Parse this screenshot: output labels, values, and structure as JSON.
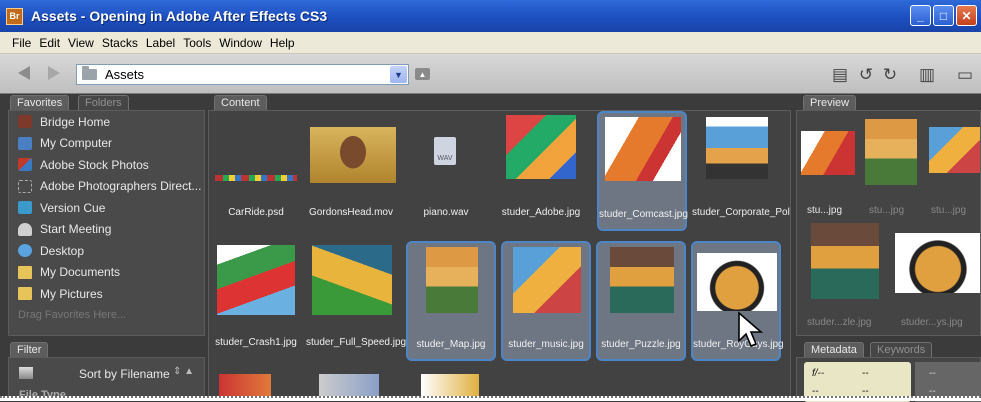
{
  "window": {
    "title": "Assets - Opening in Adobe After Effects CS3",
    "logo": "Br"
  },
  "menu": [
    "File",
    "Edit",
    "View",
    "Stacks",
    "Label",
    "Tools",
    "Window",
    "Help"
  ],
  "toolbar": {
    "path": "Assets"
  },
  "tabs": {
    "favorites": "Favorites",
    "folders": "Folders",
    "content": "Content",
    "preview": "Preview",
    "filter": "Filter",
    "metadata": "Metadata",
    "keywords": "Keywords"
  },
  "favorites": [
    {
      "label": "Bridge Home",
      "icon": "bridge-icon"
    },
    {
      "label": "My Computer",
      "icon": "computer-icon"
    },
    {
      "label": "Adobe Stock Photos",
      "icon": "stock-photos-icon"
    },
    {
      "label": "Adobe Photographers Direct...",
      "icon": "photographers-icon"
    },
    {
      "label": "Version Cue",
      "icon": "version-cue-icon"
    },
    {
      "label": "Start Meeting",
      "icon": "meeting-icon"
    },
    {
      "label": "Desktop",
      "icon": "desktop-icon"
    },
    {
      "label": "My Documents",
      "icon": "folder-icon"
    },
    {
      "label": "My Pictures",
      "icon": "folder-icon"
    },
    {
      "label": "Drag Favorites Here...",
      "icon": ""
    }
  ],
  "filter": {
    "sort": "Sort by Filename",
    "section": "File Type"
  },
  "content": {
    "row1": [
      "CarRide.psd",
      "GordonsHead.mov",
      "piano.wav",
      "studer_Adobe.jpg",
      "studer_Comcast.jpg",
      "studer_Corporate_Politics.jpg"
    ],
    "row2": [
      "studer_Crash1.jpg",
      "studer_Full_Speed.jpg",
      "studer_Map.jpg",
      "studer_music.jpg",
      "studer_Puzzle.jpg",
      "studer_RoyGuys.jpg"
    ]
  },
  "preview": {
    "labels": [
      "stu...jpg",
      "stu...jpg",
      "stu...jpg",
      "studer...zle.jpg",
      "studer...ys.jpg"
    ]
  },
  "metadata": {
    "f": "f/--",
    "d1": "--",
    "d2": "--",
    "d3": "--",
    "d4": "--",
    "d5": "--"
  }
}
